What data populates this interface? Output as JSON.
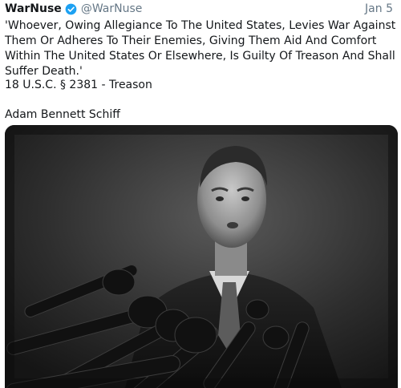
{
  "tweet": {
    "author_name": "WarNuse",
    "author_handle": "@WarNuse",
    "date": "Jan 5",
    "verified_icon": "verified-badge-icon",
    "text": "'Whoever, Owing Allegiance To The United States, Levies War Against Them Or Adheres To Their Enemies, Giving Them Aid And Comfort Within The United States Or Elsewhere, Is Guilty Of Treason And Shall Suffer Death.'",
    "citation": "18 U.S.C. § 2381 - Treason",
    "signature": "Adam Bennett Schiff"
  },
  "colors": {
    "verified_blue": "#1da1f2",
    "muted": "#657786",
    "text": "#14171a"
  }
}
